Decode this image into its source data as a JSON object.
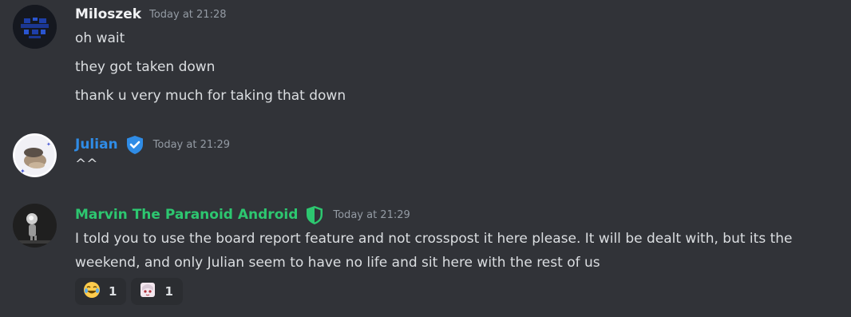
{
  "messages": [
    {
      "username": "Miloszek",
      "username_color": "#f2f3f5",
      "timestamp": "Today at 21:28",
      "lines": [
        "oh wait",
        "they got taken down",
        "thank u very much for taking that down"
      ]
    },
    {
      "username": "Julian",
      "username_color": "#2f8ce6",
      "badge_icon": "verified-shield-icon",
      "timestamp": "Today at 21:29",
      "lines": [
        "^^"
      ]
    },
    {
      "username": "Marvin The Paranoid Android",
      "username_color": "#2dc770",
      "badge_icon": "moderator-shield-icon",
      "timestamp": "Today at 21:29",
      "lines": [
        "I told you to use the board report feature and not crosspost it here please. It will be dealt with, but its the weekend, and only Julian seem to have no life and sit here with the rest of us"
      ],
      "reactions": [
        {
          "emoji_icon": "joy-emoji-icon",
          "count": "1"
        },
        {
          "emoji_icon": "anime-girl-emoji-icon",
          "count": "1"
        }
      ]
    }
  ]
}
